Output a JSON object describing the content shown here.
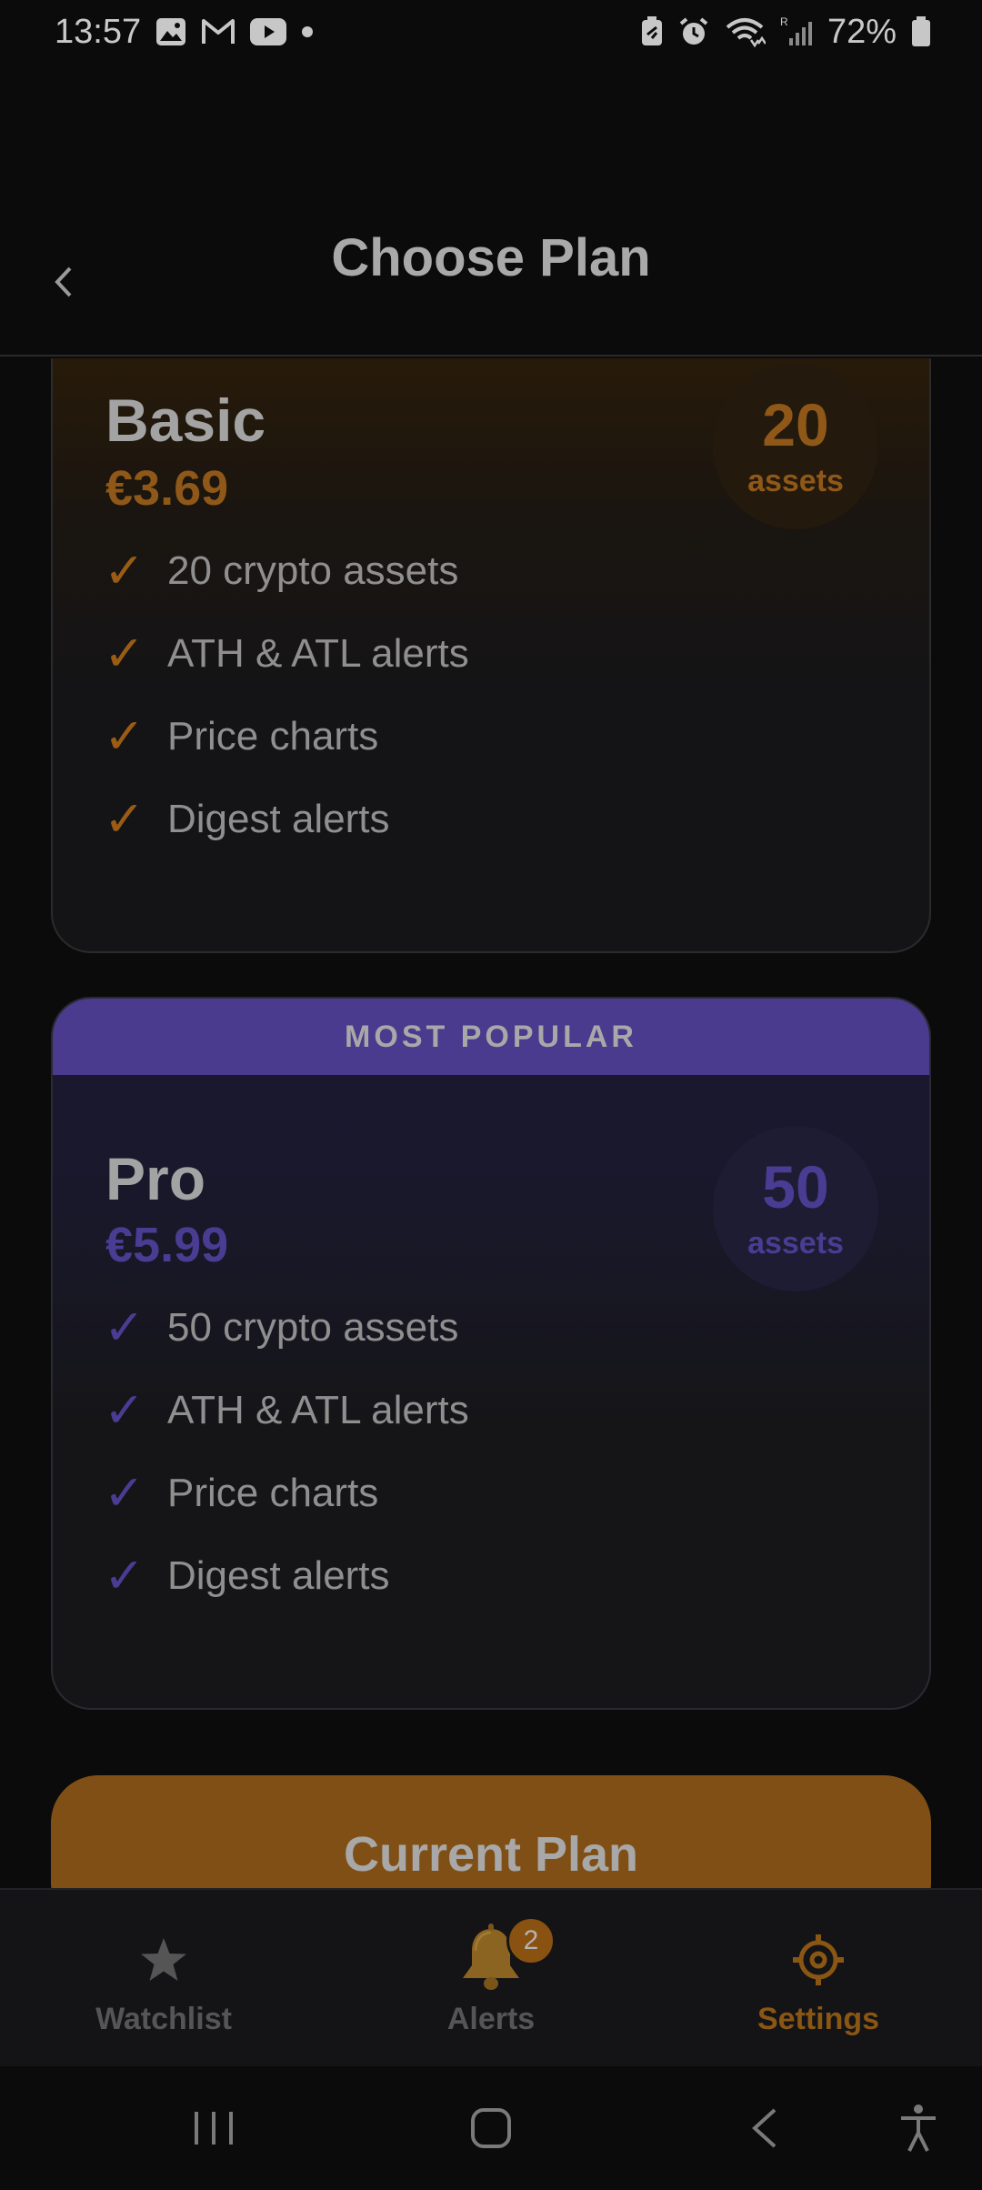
{
  "status_bar": {
    "time": "13:57",
    "battery": "72%",
    "left_icons": [
      "gallery-icon",
      "gmail-icon",
      "youtube-icon",
      "dot-icon"
    ],
    "right_icons": [
      "battery-saver-icon",
      "alarm-icon",
      "wifi-icon",
      "signal-icon",
      "battery-icon"
    ]
  },
  "header": {
    "title": "Choose Plan"
  },
  "plans": [
    {
      "name": "Basic",
      "price": "€3.69",
      "badge_number": "20",
      "badge_unit": "assets",
      "accent": "#8f5818",
      "features": [
        "20 crypto assets",
        "ATH & ATL alerts",
        "Price charts",
        "Digest alerts"
      ]
    },
    {
      "banner": "MOST POPULAR",
      "name": "Pro",
      "price": "€5.99",
      "badge_number": "50",
      "badge_unit": "assets",
      "accent": "#4a3c92",
      "features": [
        "50 crypto assets",
        "ATH & ATL alerts",
        "Price charts",
        "Digest alerts"
      ]
    }
  ],
  "current_plan_button": "Current Plan",
  "bottom_nav": {
    "items": [
      {
        "label": "Watchlist",
        "icon": "star-icon"
      },
      {
        "label": "Alerts",
        "icon": "bell-icon",
        "badge": "2"
      },
      {
        "label": "Settings",
        "icon": "gear-icon",
        "active": true
      }
    ]
  },
  "system_nav": [
    "recents-icon",
    "home-icon",
    "back-icon",
    "accessibility-icon"
  ]
}
